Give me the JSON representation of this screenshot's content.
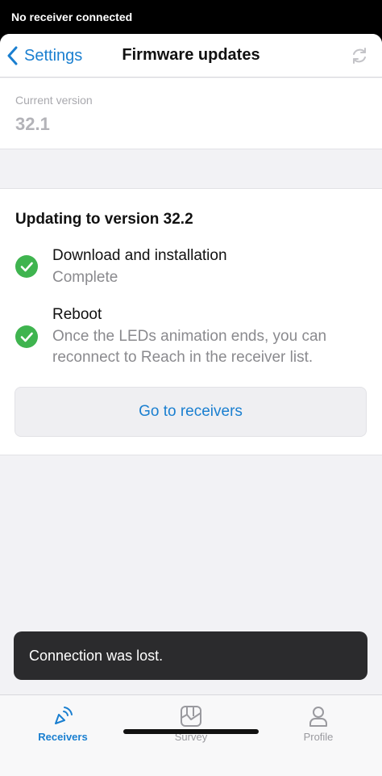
{
  "status_bar": {
    "text": "No receiver connected"
  },
  "nav": {
    "back_label": "Settings",
    "title": "Firmware updates",
    "refresh_icon": "refresh-icon"
  },
  "current_version": {
    "label": "Current version",
    "value": "32.1"
  },
  "update": {
    "title": "Updating to version 32.2",
    "steps": [
      {
        "title": "Download and installation",
        "subtitle": "Complete",
        "status": "done"
      },
      {
        "title": "Reboot",
        "subtitle": "Once the LEDs animation ends, you can reconnect to Reach in the receiver list.",
        "status": "done"
      }
    ],
    "button_label": "Go to receivers"
  },
  "toast": {
    "message": "Connection was lost."
  },
  "tabs": [
    {
      "label": "Receivers",
      "icon": "receivers-icon",
      "active": true
    },
    {
      "label": "Survey",
      "icon": "survey-icon",
      "active": false
    },
    {
      "label": "Profile",
      "icon": "profile-icon",
      "active": false
    }
  ],
  "colors": {
    "accent": "#1a7fd0",
    "success": "#3fb44f",
    "toast_bg": "#2b2b2d"
  }
}
